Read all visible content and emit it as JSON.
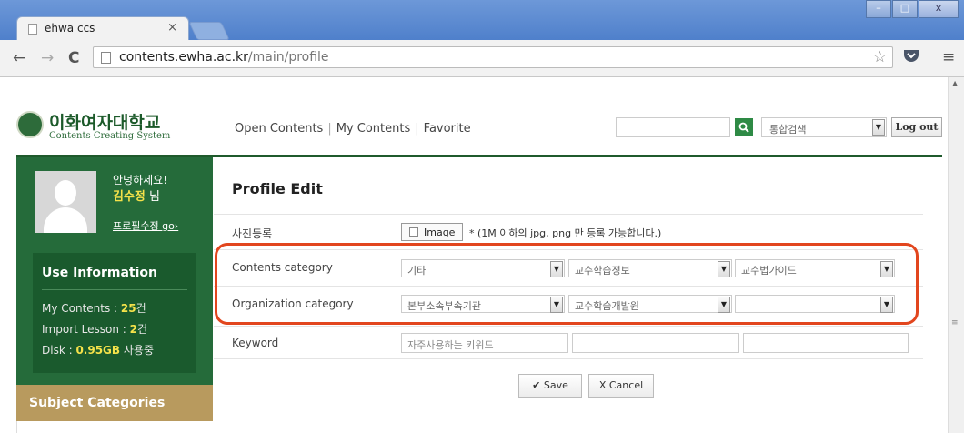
{
  "browser": {
    "tab_title": "ehwa ccs",
    "tab_close": "×",
    "url_domain": "contents.ewha.ac.kr",
    "url_path": "/main/profile",
    "nav_back": "←",
    "nav_forward": "→",
    "nav_reload": "C",
    "star": "☆",
    "menu": "≡",
    "window_buttons": [
      "–",
      "□",
      "x"
    ]
  },
  "header": {
    "logo_name": "이화여자대학교",
    "logo_sub": "Contents Creating System",
    "menu": [
      "Open Contents",
      "My Contents",
      "Favorite"
    ],
    "menu_sep": "|",
    "search_icon": "search-icon",
    "search_scope": "통합검색",
    "logout": "Log out"
  },
  "sidebar": {
    "greeting": "안녕하세요!",
    "user_name": "김수정",
    "user_suffix": "님",
    "profile_edit": "프로필수정 go›",
    "info_title": "Use Information",
    "my_contents_label": "My Contents : ",
    "my_contents_value": "25",
    "my_contents_unit": "건",
    "import_label": "Import Lesson : ",
    "import_value": "2",
    "import_unit": "건",
    "disk_label": "Disk : ",
    "disk_value": "0.95GB",
    "disk_unit": " 사용중",
    "subject_categories": "Subject Categories"
  },
  "main": {
    "title": "Profile Edit",
    "photo_label": "사진등록",
    "image_button": "Image",
    "image_note": "* (1M 이하의 jpg, png 만 등록 가능합니다.)",
    "contents_category_label": "Contents category",
    "contents_category": [
      "기타",
      "교수학습정보",
      "교수법가이드"
    ],
    "organization_category_label": "Organization category",
    "organization_category": [
      "본부소속부속기관",
      "교수학습개발원",
      ""
    ],
    "keyword_label": "Keyword",
    "keyword_placeholders": [
      "자주사용하는 키워드",
      "",
      ""
    ],
    "save": "Save",
    "cancel": "X Cancel",
    "save_icon": "✔"
  },
  "colors": {
    "brand_green": "#256b3a",
    "highlight_red": "#e2461e",
    "accent_yellow": "#f5e24a",
    "subject_gold": "#b89a5e"
  }
}
